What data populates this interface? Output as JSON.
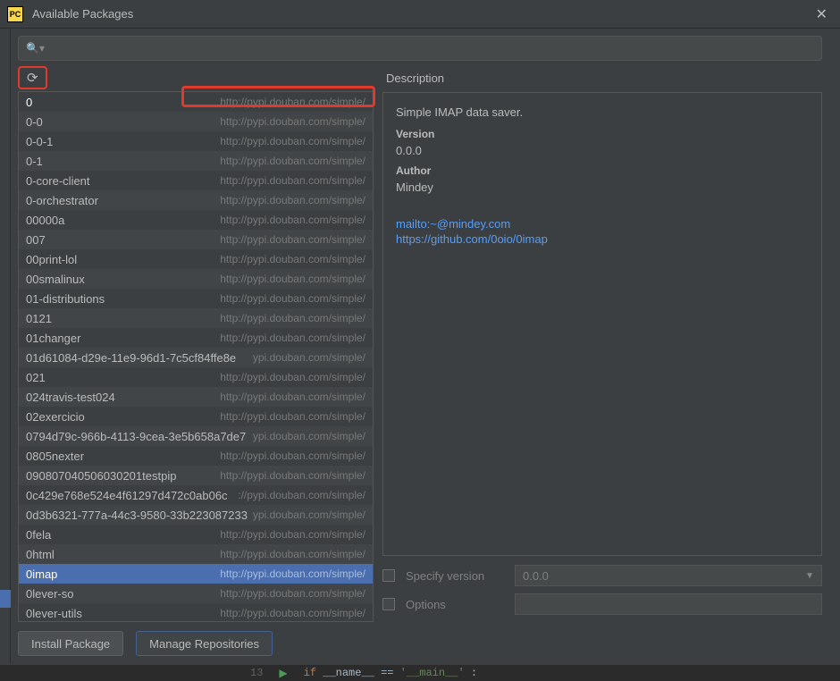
{
  "window": {
    "title": "Available Packages",
    "app_icon_text": "PC"
  },
  "search": {
    "placeholder": ""
  },
  "repo_url": "http://pypi.douban.com/simple/",
  "repo_url_trunc1": "ypi.douban.com/simple/",
  "repo_url_trunc2": "://pypi.douban.com/simple/",
  "packages": [
    {
      "name": "0"
    },
    {
      "name": "0-0"
    },
    {
      "name": "0-0-1"
    },
    {
      "name": "0-1"
    },
    {
      "name": "0-core-client"
    },
    {
      "name": "0-orchestrator"
    },
    {
      "name": "00000a"
    },
    {
      "name": "007"
    },
    {
      "name": "00print-lol"
    },
    {
      "name": "00smalinux"
    },
    {
      "name": "01-distributions"
    },
    {
      "name": "0121"
    },
    {
      "name": "01changer"
    },
    {
      "name": "01d61084-d29e-11e9-96d1-7c5cf84ffe8e",
      "trunc": 1
    },
    {
      "name": "021"
    },
    {
      "name": "024travis-test024"
    },
    {
      "name": "02exercicio"
    },
    {
      "name": "0794d79c-966b-4113-9cea-3e5b658a7de7",
      "trunc": 1
    },
    {
      "name": "0805nexter"
    },
    {
      "name": "090807040506030201testpip"
    },
    {
      "name": "0c429e768e524e4f61297d472c0ab06c",
      "trunc": 2
    },
    {
      "name": "0d3b6321-777a-44c3-9580-33b223087233",
      "trunc": 1
    },
    {
      "name": "0fela"
    },
    {
      "name": "0html"
    },
    {
      "name": "0imap",
      "selected": true
    },
    {
      "name": "0lever-so"
    },
    {
      "name": "0lever-utils"
    }
  ],
  "description": {
    "header": "Description",
    "summary": "Simple IMAP data saver.",
    "version_label": "Version",
    "version": "0.0.0",
    "author_label": "Author",
    "author": "Mindey",
    "links": [
      "mailto:~@mindey.com",
      "https://github.com/0oio/0imap"
    ]
  },
  "options": {
    "specify_version_label": "Specify version",
    "specify_version_value": "0.0.0",
    "options_label": "Options",
    "options_value": ""
  },
  "footer": {
    "install": "Install Package",
    "manage": "Manage Repositories"
  },
  "editor": {
    "line_no": "13",
    "kw_if": "if",
    "ident_name": "__name__",
    "op_eq": "==",
    "str_main": "'__main__'",
    "colon": ":"
  }
}
